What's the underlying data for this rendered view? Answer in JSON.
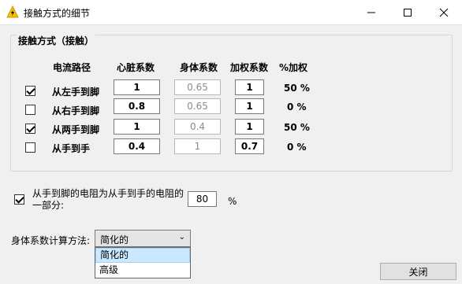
{
  "window": {
    "title": "接触方式的细节",
    "icon": "lightning-warning-icon"
  },
  "group": {
    "title": "接触方式（接触）",
    "headers": {
      "path": "电流路径",
      "heart": "心脏系数",
      "body": "身体系数",
      "weight": "加权系数",
      "pct": "%加权"
    },
    "rows": [
      {
        "checked": true,
        "label": "从左手到脚",
        "heart": "1",
        "body": "0.65",
        "weight": "1",
        "pct": "50 %"
      },
      {
        "checked": false,
        "label": "从右手到脚",
        "heart": "0.8",
        "body": "0.65",
        "weight": "1",
        "pct": "0 %"
      },
      {
        "checked": true,
        "label": "从两手到脚",
        "heart": "1",
        "body": "0.4",
        "weight": "1",
        "pct": "50 %"
      },
      {
        "checked": false,
        "label": "从手到手",
        "heart": "0.4",
        "body": "1",
        "weight": "0.7",
        "pct": "0 %"
      }
    ]
  },
  "resistance": {
    "checked": true,
    "text": "从手到脚的电阻为从手到手的电阻的一部分:",
    "value": "80",
    "unit": "%"
  },
  "calc": {
    "label": "身体系数计算方法:",
    "selected": "简化的",
    "options": [
      "简化的",
      "高级"
    ]
  },
  "buttons": {
    "close": "关闭"
  }
}
